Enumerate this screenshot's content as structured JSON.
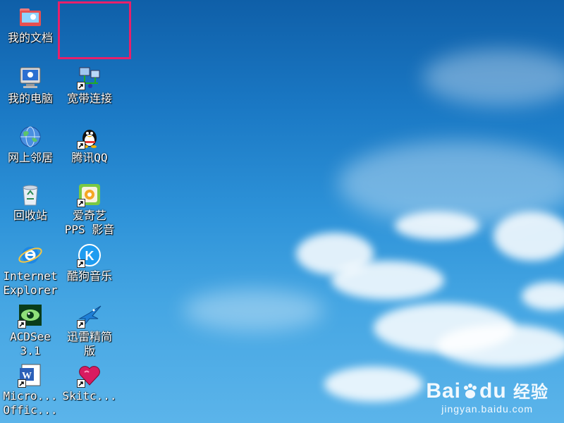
{
  "desktop": {
    "icons": [
      {
        "id": "my-documents",
        "label": "我的文档",
        "shortcut": false,
        "icon": "folder-icon"
      },
      {
        "id": "my-computer",
        "label": "我的电脑",
        "shortcut": false,
        "icon": "computer-icon"
      },
      {
        "id": "broadband",
        "label": "宽带连接",
        "shortcut": true,
        "icon": "network-connection-icon"
      },
      {
        "id": "network-places",
        "label": "网上邻居",
        "shortcut": false,
        "icon": "globe-network-icon"
      },
      {
        "id": "qq",
        "label": "腾讯QQ",
        "shortcut": true,
        "icon": "qq-penguin-icon"
      },
      {
        "id": "recycle-bin",
        "label": "回收站",
        "shortcut": false,
        "icon": "recycle-bin-icon"
      },
      {
        "id": "iqiyi",
        "label": "爱奇艺\nPPS 影音",
        "shortcut": true,
        "icon": "iqiyi-pps-icon"
      },
      {
        "id": "ie",
        "label": "Internet\nExplorer",
        "shortcut": false,
        "icon": "internet-explorer-icon"
      },
      {
        "id": "kugou",
        "label": "酷狗音乐",
        "shortcut": true,
        "icon": "kugou-music-icon"
      },
      {
        "id": "acdsee",
        "label": "ACDSee\n3.1",
        "shortcut": true,
        "icon": "acdsee-eye-icon"
      },
      {
        "id": "xunlei",
        "label": "迅雷精简\n版",
        "shortcut": true,
        "icon": "xunlei-bird-icon"
      },
      {
        "id": "word",
        "label": "Micro...\nOffic...",
        "shortcut": true,
        "icon": "word-document-icon"
      },
      {
        "id": "skitch",
        "label": "Skitc...",
        "shortcut": true,
        "icon": "skitch-heart-icon"
      }
    ]
  },
  "watermark": {
    "logo_text": "Bai",
    "logo_text2": "du",
    "logo_suffix": "经验",
    "url": "jingyan.baidu.com"
  },
  "colors": {
    "selection": "#e8206a",
    "sky_top": "#0f5fa8",
    "sky_bottom": "#5bb4ea"
  }
}
